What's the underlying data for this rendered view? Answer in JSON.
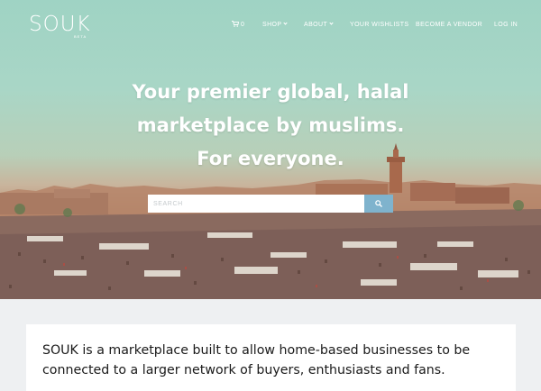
{
  "brand": {
    "name": "SOUK",
    "tagline": "BETA"
  },
  "nav": {
    "cart_count": "0",
    "shop": "SHOP",
    "about": "ABOUT",
    "wishlists": "YOUR WISHLISTS",
    "vendor": "BECOME A VENDOR",
    "login": "LOG IN"
  },
  "hero": {
    "line1": "Your premier global, halal",
    "line2": "marketplace by muslims.",
    "line3": "For everyone."
  },
  "search": {
    "placeholder": "SEARCH",
    "value": ""
  },
  "about": {
    "text": "SOUK is a marketplace built to allow home-based businesses to be connected to a larger network of buyers, enthusiasts and fans."
  },
  "colors": {
    "search_button": "#7fb3cd",
    "page_background": "#eef0f2",
    "hero_sky": "#a9d6c6"
  },
  "icons": {
    "cart": "cart-icon",
    "search": "search-icon",
    "dropdown": "chevron-down-icon"
  }
}
